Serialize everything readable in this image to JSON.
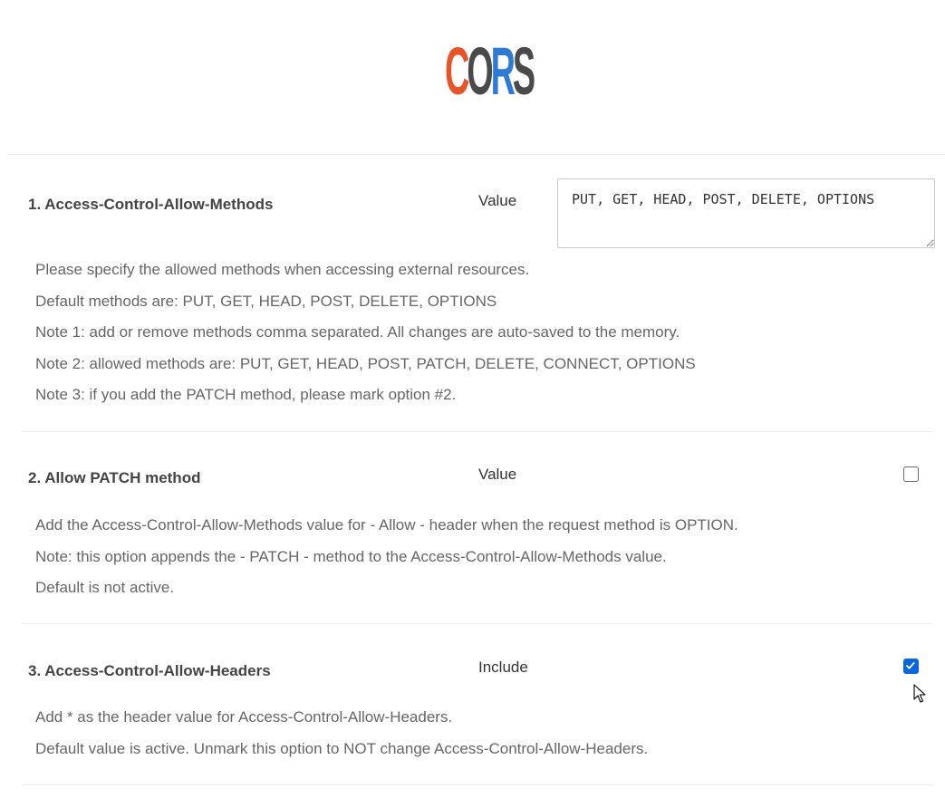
{
  "logo": {
    "text": "CORS",
    "colors": [
      "#e8532a",
      "#4a4a4a",
      "#2e7bd6",
      "#4a4a4a"
    ]
  },
  "sections": [
    {
      "title": "1. Access-Control-Allow-Methods",
      "value_label": "Value",
      "input_value": "PUT, GET, HEAD, POST, DELETE, OPTIONS",
      "description": [
        "Please specify the allowed methods when accessing external resources.",
        "Default methods are: PUT, GET, HEAD, POST, DELETE, OPTIONS",
        "Note 1: add or remove methods comma separated. All changes are auto-saved to the memory.",
        "Note 2: allowed methods are: PUT, GET, HEAD, POST, PATCH, DELETE, CONNECT, OPTIONS",
        "Note 3: if you add the PATCH method, please mark option #2."
      ]
    },
    {
      "title": "2. Allow PATCH method",
      "value_label": "Value",
      "checked": false,
      "description": [
        "Add the Access-Control-Allow-Methods value for - Allow - header when the request method is OPTION.",
        "Note: this option appends the - PATCH - method to the Access-Control-Allow-Methods value.",
        "Default is not active."
      ]
    },
    {
      "title": "3. Access-Control-Allow-Headers",
      "value_label": "Include",
      "checked": true,
      "description": [
        "Add * as the header value for Access-Control-Allow-Headers.",
        "Default value is active. Unmark this option to NOT change Access-Control-Allow-Headers."
      ]
    }
  ],
  "colors": {
    "accent": "#0a66e0",
    "title_text": "#444444",
    "description_text": "#666666",
    "divider": "#eeeeee"
  }
}
